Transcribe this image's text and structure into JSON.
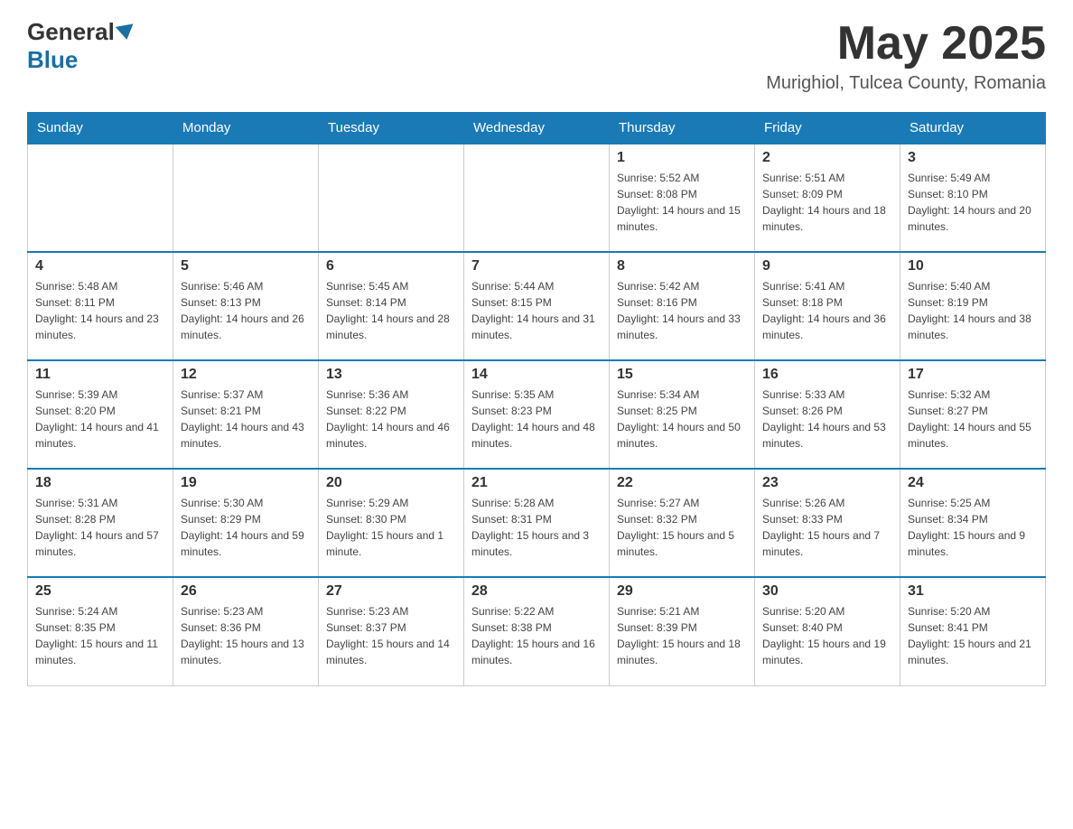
{
  "header": {
    "logo_general": "General",
    "logo_blue": "Blue",
    "month_title": "May 2025",
    "location": "Murighiol, Tulcea County, Romania"
  },
  "days_of_week": [
    "Sunday",
    "Monday",
    "Tuesday",
    "Wednesday",
    "Thursday",
    "Friday",
    "Saturday"
  ],
  "weeks": [
    [
      {
        "day": "",
        "info": ""
      },
      {
        "day": "",
        "info": ""
      },
      {
        "day": "",
        "info": ""
      },
      {
        "day": "",
        "info": ""
      },
      {
        "day": "1",
        "info": "Sunrise: 5:52 AM\nSunset: 8:08 PM\nDaylight: 14 hours and 15 minutes."
      },
      {
        "day": "2",
        "info": "Sunrise: 5:51 AM\nSunset: 8:09 PM\nDaylight: 14 hours and 18 minutes."
      },
      {
        "day": "3",
        "info": "Sunrise: 5:49 AM\nSunset: 8:10 PM\nDaylight: 14 hours and 20 minutes."
      }
    ],
    [
      {
        "day": "4",
        "info": "Sunrise: 5:48 AM\nSunset: 8:11 PM\nDaylight: 14 hours and 23 minutes."
      },
      {
        "day": "5",
        "info": "Sunrise: 5:46 AM\nSunset: 8:13 PM\nDaylight: 14 hours and 26 minutes."
      },
      {
        "day": "6",
        "info": "Sunrise: 5:45 AM\nSunset: 8:14 PM\nDaylight: 14 hours and 28 minutes."
      },
      {
        "day": "7",
        "info": "Sunrise: 5:44 AM\nSunset: 8:15 PM\nDaylight: 14 hours and 31 minutes."
      },
      {
        "day": "8",
        "info": "Sunrise: 5:42 AM\nSunset: 8:16 PM\nDaylight: 14 hours and 33 minutes."
      },
      {
        "day": "9",
        "info": "Sunrise: 5:41 AM\nSunset: 8:18 PM\nDaylight: 14 hours and 36 minutes."
      },
      {
        "day": "10",
        "info": "Sunrise: 5:40 AM\nSunset: 8:19 PM\nDaylight: 14 hours and 38 minutes."
      }
    ],
    [
      {
        "day": "11",
        "info": "Sunrise: 5:39 AM\nSunset: 8:20 PM\nDaylight: 14 hours and 41 minutes."
      },
      {
        "day": "12",
        "info": "Sunrise: 5:37 AM\nSunset: 8:21 PM\nDaylight: 14 hours and 43 minutes."
      },
      {
        "day": "13",
        "info": "Sunrise: 5:36 AM\nSunset: 8:22 PM\nDaylight: 14 hours and 46 minutes."
      },
      {
        "day": "14",
        "info": "Sunrise: 5:35 AM\nSunset: 8:23 PM\nDaylight: 14 hours and 48 minutes."
      },
      {
        "day": "15",
        "info": "Sunrise: 5:34 AM\nSunset: 8:25 PM\nDaylight: 14 hours and 50 minutes."
      },
      {
        "day": "16",
        "info": "Sunrise: 5:33 AM\nSunset: 8:26 PM\nDaylight: 14 hours and 53 minutes."
      },
      {
        "day": "17",
        "info": "Sunrise: 5:32 AM\nSunset: 8:27 PM\nDaylight: 14 hours and 55 minutes."
      }
    ],
    [
      {
        "day": "18",
        "info": "Sunrise: 5:31 AM\nSunset: 8:28 PM\nDaylight: 14 hours and 57 minutes."
      },
      {
        "day": "19",
        "info": "Sunrise: 5:30 AM\nSunset: 8:29 PM\nDaylight: 14 hours and 59 minutes."
      },
      {
        "day": "20",
        "info": "Sunrise: 5:29 AM\nSunset: 8:30 PM\nDaylight: 15 hours and 1 minute."
      },
      {
        "day": "21",
        "info": "Sunrise: 5:28 AM\nSunset: 8:31 PM\nDaylight: 15 hours and 3 minutes."
      },
      {
        "day": "22",
        "info": "Sunrise: 5:27 AM\nSunset: 8:32 PM\nDaylight: 15 hours and 5 minutes."
      },
      {
        "day": "23",
        "info": "Sunrise: 5:26 AM\nSunset: 8:33 PM\nDaylight: 15 hours and 7 minutes."
      },
      {
        "day": "24",
        "info": "Sunrise: 5:25 AM\nSunset: 8:34 PM\nDaylight: 15 hours and 9 minutes."
      }
    ],
    [
      {
        "day": "25",
        "info": "Sunrise: 5:24 AM\nSunset: 8:35 PM\nDaylight: 15 hours and 11 minutes."
      },
      {
        "day": "26",
        "info": "Sunrise: 5:23 AM\nSunset: 8:36 PM\nDaylight: 15 hours and 13 minutes."
      },
      {
        "day": "27",
        "info": "Sunrise: 5:23 AM\nSunset: 8:37 PM\nDaylight: 15 hours and 14 minutes."
      },
      {
        "day": "28",
        "info": "Sunrise: 5:22 AM\nSunset: 8:38 PM\nDaylight: 15 hours and 16 minutes."
      },
      {
        "day": "29",
        "info": "Sunrise: 5:21 AM\nSunset: 8:39 PM\nDaylight: 15 hours and 18 minutes."
      },
      {
        "day": "30",
        "info": "Sunrise: 5:20 AM\nSunset: 8:40 PM\nDaylight: 15 hours and 19 minutes."
      },
      {
        "day": "31",
        "info": "Sunrise: 5:20 AM\nSunset: 8:41 PM\nDaylight: 15 hours and 21 minutes."
      }
    ]
  ]
}
